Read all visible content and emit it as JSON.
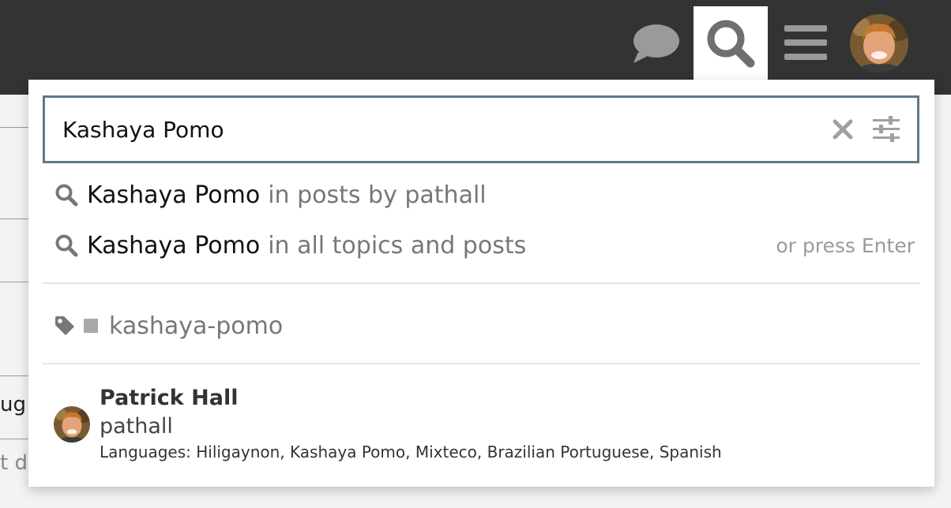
{
  "header": {
    "icons": [
      "chat-icon",
      "search-icon",
      "hamburger-menu-icon",
      "user-avatar"
    ],
    "background_color": "#333333"
  },
  "background_fragments": {
    "frag1": "ug",
    "frag2": "t d"
  },
  "search": {
    "value": "Kashaya Pomo",
    "border_color": "#617987",
    "clear_icon": "close-icon",
    "advanced_icon": "sliders-icon"
  },
  "suggestions": [
    {
      "term": "Kashaya Pomo",
      "context": "in posts by pathall",
      "hint": ""
    },
    {
      "term": "Kashaya Pomo",
      "context": "in all topics and posts",
      "hint": "or press Enter"
    }
  ],
  "tag": {
    "icon": "tag-icon",
    "name": "kashaya-pomo"
  },
  "user": {
    "name": "Patrick Hall",
    "username": "pathall",
    "languages": "Languages: Hiligaynon, Kashaya Pomo, Mixteco, Brazilian Portuguese, Spanish"
  }
}
